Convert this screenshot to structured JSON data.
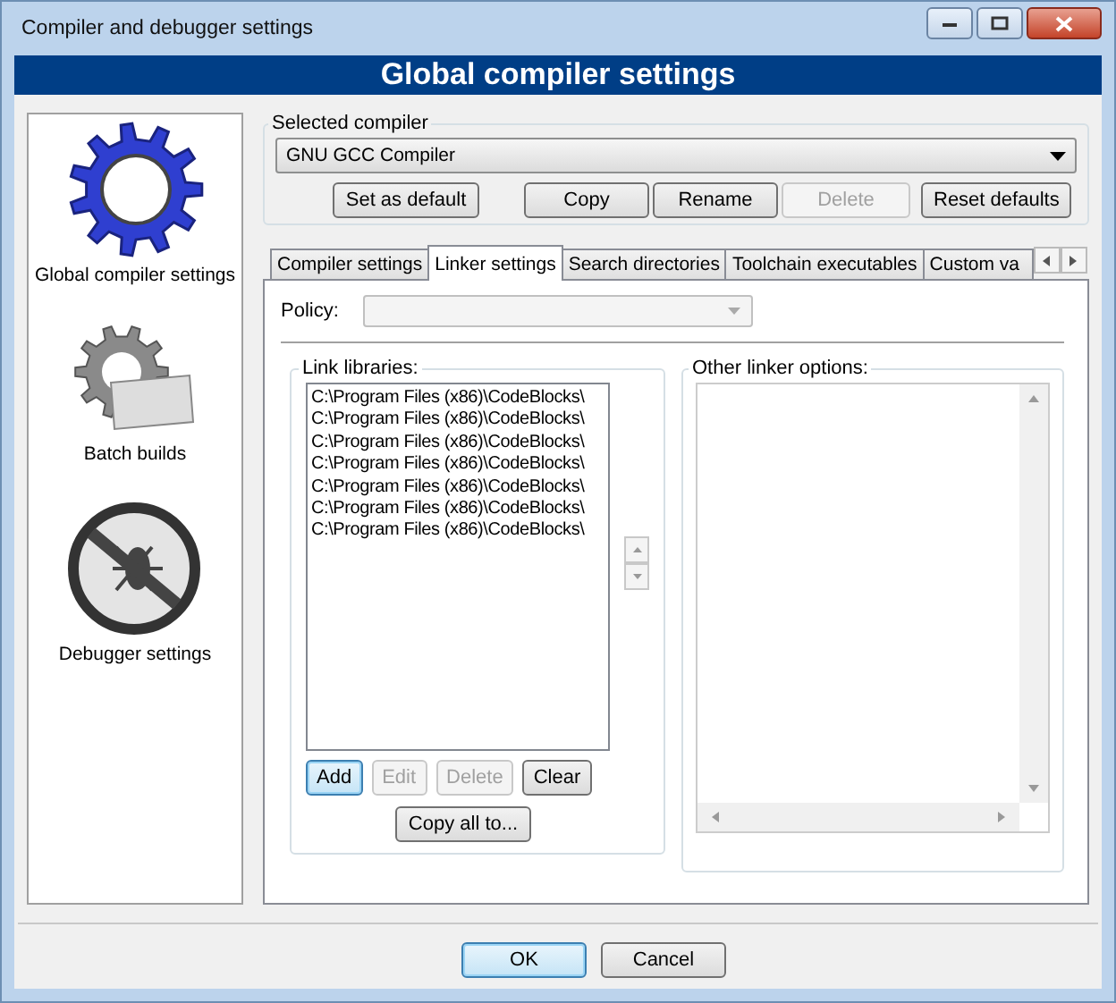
{
  "window": {
    "title": "Compiler and debugger settings"
  },
  "header": "Global compiler settings",
  "sidebar": {
    "items": [
      {
        "kind": "gear",
        "label": "Global compiler settings"
      },
      {
        "kind": "batch",
        "label": "Batch builds"
      },
      {
        "kind": "debugger",
        "label": "Debugger settings"
      }
    ]
  },
  "compiler": {
    "group_label": "Selected compiler",
    "value": "GNU GCC Compiler",
    "buttons": [
      {
        "label": "Set as default",
        "disabled": false
      },
      {
        "label": "Copy",
        "disabled": false
      },
      {
        "label": "Rename",
        "disabled": false
      },
      {
        "label": "Delete",
        "disabled": true
      },
      {
        "label": "Reset defaults",
        "disabled": false
      }
    ]
  },
  "tabs": [
    {
      "label": "Compiler settings",
      "selected": false
    },
    {
      "label": "Linker settings",
      "selected": true
    },
    {
      "label": "Search directories",
      "selected": false
    },
    {
      "label": "Toolchain executables",
      "selected": false
    },
    {
      "label": "Custom va",
      "selected": false
    }
  ],
  "policy": {
    "label": "Policy:",
    "disabled": true
  },
  "link_libraries": {
    "label": "Link libraries:",
    "items": [
      "C:\\Program Files (x86)\\CodeBlocks\\",
      "C:\\Program Files (x86)\\CodeBlocks\\",
      "C:\\Program Files (x86)\\CodeBlocks\\",
      "C:\\Program Files (x86)\\CodeBlocks\\",
      "C:\\Program Files (x86)\\CodeBlocks\\",
      "C:\\Program Files (x86)\\CodeBlocks\\",
      "C:\\Program Files (x86)\\CodeBlocks\\"
    ],
    "buttons": [
      {
        "label": "Add",
        "disabled": false,
        "focused": true
      },
      {
        "label": "Edit",
        "disabled": true,
        "focused": false
      },
      {
        "label": "Delete",
        "disabled": true,
        "focused": false
      },
      {
        "label": "Clear",
        "disabled": false,
        "focused": false
      }
    ],
    "copy_button": "Copy all to..."
  },
  "other_linker_options": {
    "label": "Other linker options:"
  },
  "footer_buttons": [
    {
      "label": "OK",
      "focused": true
    },
    {
      "label": "Cancel",
      "focused": false
    }
  ]
}
